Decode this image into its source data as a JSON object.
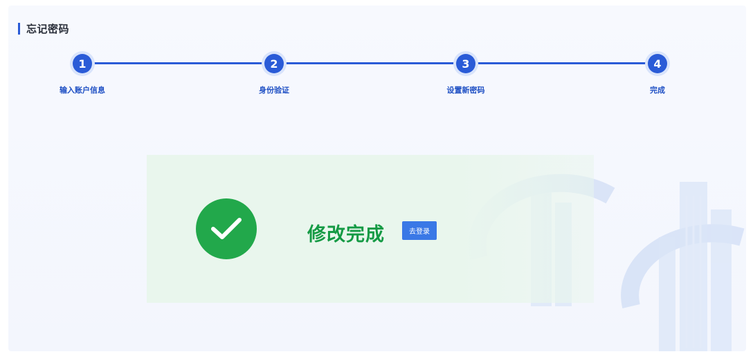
{
  "header": {
    "title": "忘记密码"
  },
  "steps": [
    {
      "number": "1",
      "label": "输入账户信息"
    },
    {
      "number": "2",
      "label": "身份验证"
    },
    {
      "number": "3",
      "label": "设置新密码"
    },
    {
      "number": "4",
      "label": "完成"
    }
  ],
  "current_step": 4,
  "result": {
    "message": "修改完成",
    "button_label": "去登录"
  },
  "icons": {
    "success": "check-circle-icon",
    "watermark": "emblem-watermark-icon"
  },
  "colors": {
    "primary": "#2a5bd7",
    "success": "#22a84b",
    "success_text": "#149a44",
    "result_background": "#e9f6ed",
    "button": "#3a78e6"
  }
}
